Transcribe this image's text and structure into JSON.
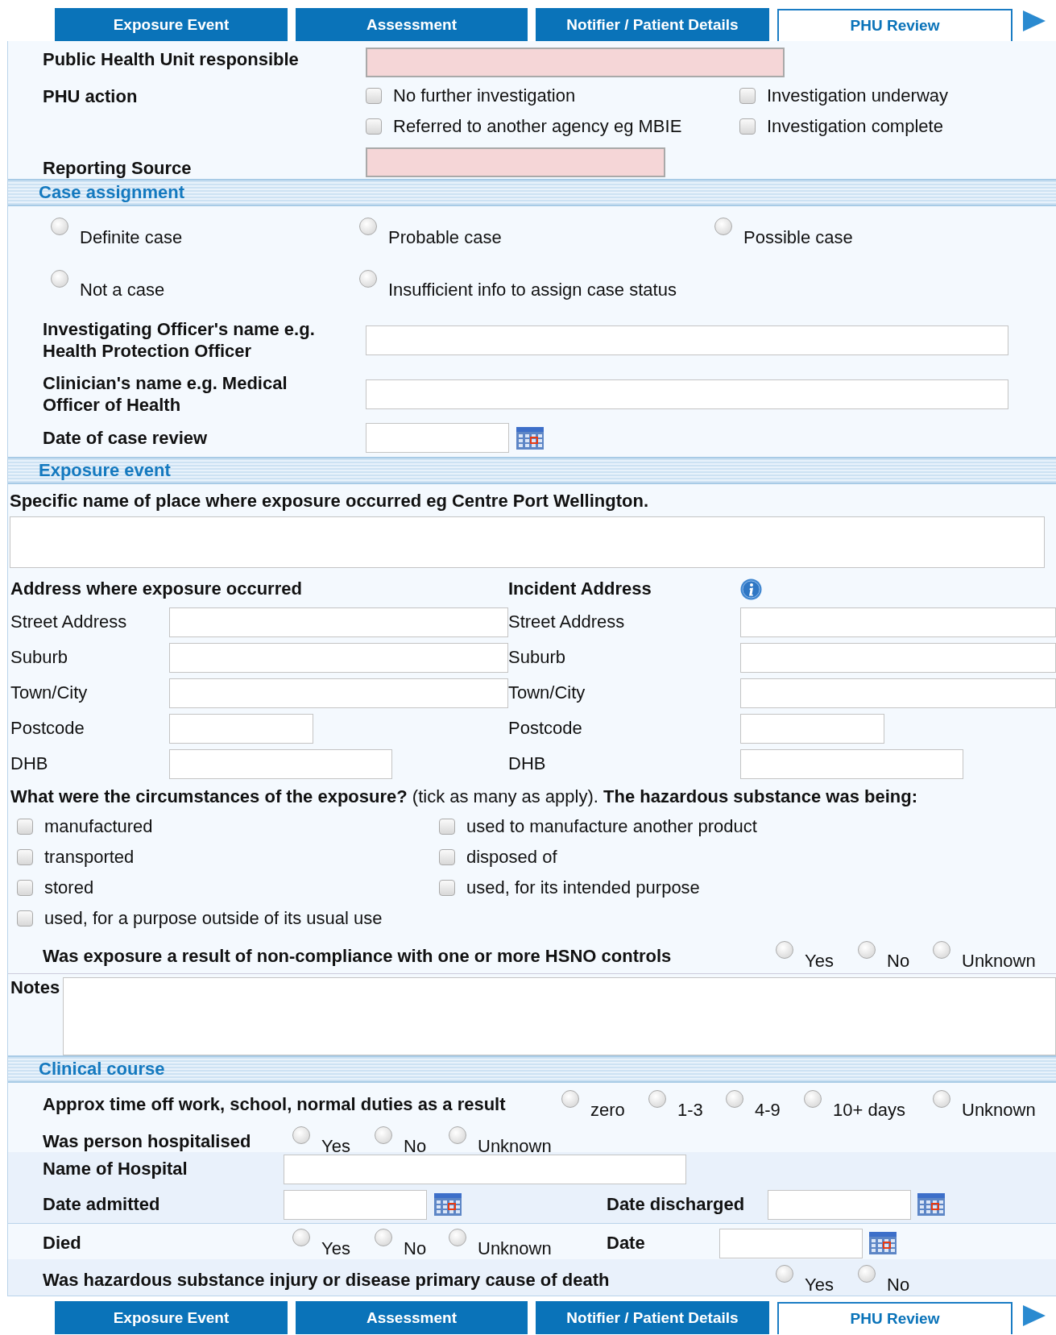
{
  "tabs": [
    {
      "label": "Exposure Event",
      "selected": false
    },
    {
      "label": "Assessment",
      "selected": false
    },
    {
      "label": "Notifier / Patient Details",
      "selected": false
    },
    {
      "label": "PHU Review",
      "selected": true
    }
  ],
  "phu": {
    "unit": {
      "label": "Public Health Unit responsible",
      "required": true
    },
    "action_label": "PHU action",
    "actions": [
      {
        "label": "No further investigation",
        "checked": false
      },
      {
        "label": "Investigation underway",
        "checked": false
      },
      {
        "label": "Referred to another agency eg MBIE",
        "checked": false
      },
      {
        "label": "Investigation complete",
        "checked": false
      }
    ],
    "source": {
      "label": "Reporting Source",
      "required": true
    }
  },
  "case_assignment": {
    "title": "Case assignment",
    "options": [
      {
        "label": "Definite case",
        "selected": false
      },
      {
        "label": "Probable case",
        "selected": false
      },
      {
        "label": "Possible case",
        "selected": false
      },
      {
        "label": "Not a case",
        "selected": false
      },
      {
        "label": "Insufficient info to assign case status",
        "selected": false
      }
    ],
    "officer_label": "Investigating Officer's name e.g. Health Protection Officer",
    "clinician_label": "Clinician's name e.g. Medical Officer of Health",
    "review_date_label": "Date of case review"
  },
  "exposure_event": {
    "title": "Exposure event",
    "place_label": "Specific name of place where exposure occurred eg Centre Port Wellington.",
    "address_heading": "Address where exposure occurred",
    "incident_heading": "Incident Address",
    "address_fields": [
      "Street Address",
      "Suburb",
      "Town/City",
      "Postcode",
      "DHB"
    ],
    "incident_fields": [
      "Street Address",
      "Suburb",
      "Town/City",
      "Postcode",
      "DHB"
    ],
    "circumstances_question": "**What were the circumstances of the exposure?** (tick as many as apply). **The hazardous substance was being:**",
    "circumstances": [
      {
        "label": "manufactured",
        "checked": false
      },
      {
        "label": "used to manufacture another product",
        "checked": false
      },
      {
        "label": "transported",
        "checked": false
      },
      {
        "label": "disposed of",
        "checked": false
      },
      {
        "label": "stored",
        "checked": false
      },
      {
        "label": "used, for its intended purpose",
        "checked": false
      },
      {
        "label": "used, for a purpose outside of its usual use",
        "checked": false
      }
    ],
    "hsno_question": "Was exposure a result of non-compliance with one or more HSNO controls",
    "hsno_options": [
      {
        "label": "Yes",
        "selected": false
      },
      {
        "label": "No",
        "selected": false
      },
      {
        "label": "Unknown",
        "selected": false
      }
    ],
    "notes_label": "Notes"
  },
  "clinical_course": {
    "title": "Clinical course",
    "time_off_label": "Approx time off work, school, normal duties as a result",
    "time_off_options": [
      {
        "label": "zero",
        "selected": false
      },
      {
        "label": "1-3",
        "selected": false
      },
      {
        "label": "4-9",
        "selected": false
      },
      {
        "label": "10+ days",
        "selected": false
      },
      {
        "label": "Unknown",
        "selected": false
      }
    ],
    "hospitalised_label": "Was person hospitalised",
    "hospitalised_options": [
      {
        "label": "Yes",
        "selected": false
      },
      {
        "label": "No",
        "selected": false
      },
      {
        "label": "Unknown",
        "selected": false
      }
    ],
    "hospital_name_label": "Name of Hospital",
    "date_admitted_label": "Date admitted",
    "date_discharged_label": "Date discharged",
    "died_label": "Died",
    "died_options": [
      {
        "label": "Yes",
        "selected": false
      },
      {
        "label": "No",
        "selected": false
      },
      {
        "label": "Unknown",
        "selected": false
      }
    ],
    "death_date_label": "Date",
    "primary_cause_label": "Was hazardous substance injury or disease primary cause of death",
    "primary_cause_options": [
      {
        "label": "Yes",
        "selected": false
      },
      {
        "label": "No",
        "selected": false
      }
    ]
  },
  "bottom_tabs": [
    {
      "label": "Exposure Event",
      "selected": false
    },
    {
      "label": "Assessment",
      "selected": false
    },
    {
      "label": "Notifier / Patient Details",
      "selected": false
    },
    {
      "label": "PHU Review",
      "selected": true
    }
  ]
}
